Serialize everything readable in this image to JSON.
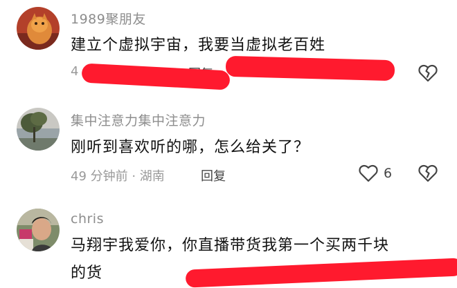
{
  "comments": [
    {
      "username": "1989聚朋友",
      "content": "建立个虚拟宇宙，我要当虚拟老百姓",
      "meta_visible": "4",
      "reply": "回复",
      "avatar": "orange-cat-avatar"
    },
    {
      "username": "集中注意力集中注意力",
      "content": "刚听到喜欢听的哪，怎么给关了？",
      "meta": "49 分钟前 · 湖南",
      "reply": "回复",
      "likes": "6",
      "avatar": "lake-tree-avatar"
    },
    {
      "username": "chris",
      "content_line1": "马翔宇我爱你，你直播带货我第一个买两千块",
      "content_line2": "的货",
      "avatar": "man-portrait-avatar"
    }
  ],
  "icons": {
    "like": "heart-outline-icon",
    "dislike": "broken-heart-icon"
  },
  "colors": {
    "redaction": "#ff1a2e",
    "username": "#8d8d8d",
    "text": "#111111",
    "meta": "#999999"
  }
}
